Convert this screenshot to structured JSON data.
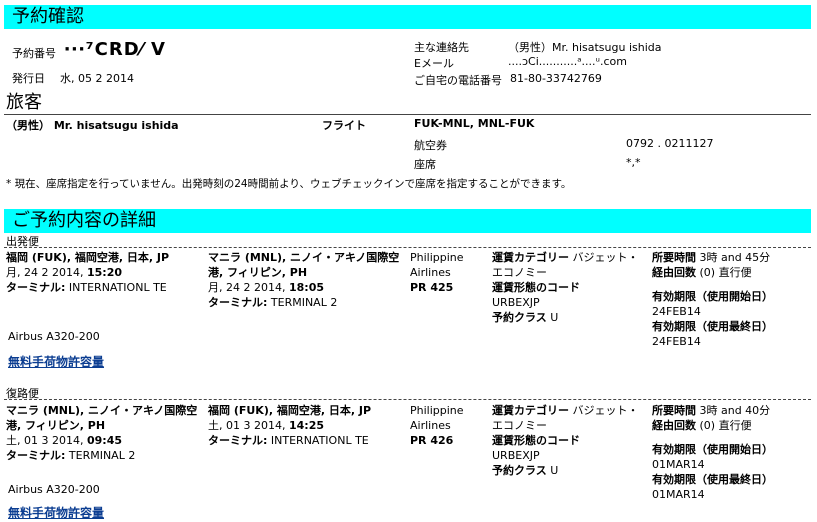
{
  "confirmation": {
    "title": "予約確認",
    "booking_no_label": "予約番号",
    "booking_no_value": "‧‧‧⁷CRD⁄ V",
    "issue_date_label": "発行日",
    "issue_date_value": "水, 05 2 2014",
    "contact_label": "主な連絡先",
    "contact_value": "（男性）Mr. hisatsugu ishida",
    "email_label": "Eメール",
    "email_value": "....ᴐCi...........ᵃ....ᵘ.com",
    "phone_label": "ご自宅の電話番号",
    "phone_value": "81-80-33742769"
  },
  "passenger": {
    "heading": "旅客",
    "name": "（男性） Mr. hisatsugu ishida",
    "flight_label": "フライト",
    "flight_value": "FUK-MNL, MNL-FUK",
    "ticket_label": "航空券",
    "ticket_value": "0792 . 0211127",
    "seat_label": "座席",
    "seat_value": "*,*",
    "note": "* 現在、座席指定を行っていません。出発時刻の24時間前より、ウェブチェックインで座席を指定することができます。"
  },
  "details": {
    "heading": "ご予約内容の詳細",
    "baggage_link": "無料手荷物許容量",
    "outbound": {
      "label": "出発便",
      "dep_airport": "福岡 (FUK), 福岡空港, 日本, JP",
      "dep_date": "月, 24 2 2014,",
      "dep_time": "15:20",
      "dep_terminal_label": "ターミナル:",
      "dep_terminal": "INTERNATIONL TE",
      "arr_airport": "マニラ (MNL), ニノイ・アキノ国際空港, フィリピン, PH",
      "arr_date": "月, 24 2 2014,",
      "arr_time": "18:05",
      "arr_terminal_label": "ターミナル:",
      "arr_terminal": "TERMINAL 2",
      "airline": "Philippine Airlines",
      "flight_no": "PR 425",
      "fare_cat_label": "運賃カテゴリー",
      "fare_cat_value": "バジェット・エコノミー",
      "fare_code_label": "運賃形態のコード",
      "fare_code_value": "URBEXJP",
      "class_label": "予約クラス",
      "class_value": "U",
      "duration_label": "所要時間",
      "duration_value": "3時 and 45分",
      "stops_label": "経由回数",
      "stops_value": "(0) 直行便",
      "valid_from_label": "有効期限（使用開始日）",
      "valid_from_value": "24FEB14",
      "valid_to_label": "有効期限（使用最終日）",
      "valid_to_value": "24FEB14",
      "aircraft": "Airbus A320-200"
    },
    "return": {
      "label": "復路便",
      "dep_airport": "マニラ (MNL), ニノイ・アキノ国際空港, フィリピン, PH",
      "dep_date": "土, 01 3 2014,",
      "dep_time": "09:45",
      "dep_terminal_label": "ターミナル:",
      "dep_terminal": "TERMINAL 2",
      "arr_airport": "福岡 (FUK), 福岡空港, 日本, JP",
      "arr_date": "土, 01 3 2014,",
      "arr_time": "14:25",
      "arr_terminal_label": "ターミナル:",
      "arr_terminal": "INTERNATIONL TE",
      "airline": "Philippine Airlines",
      "flight_no": "PR 426",
      "fare_cat_label": "運賃カテゴリー",
      "fare_cat_value": "バジェット・エコノミー",
      "fare_code_label": "運賃形態のコード",
      "fare_code_value": "URBEXJP",
      "class_label": "予約クラス",
      "class_value": "U",
      "duration_label": "所要時間",
      "duration_value": "3時 and 40分",
      "stops_label": "経由回数",
      "stops_value": "(0) 直行便",
      "valid_from_label": "有効期限（使用開始日）",
      "valid_from_value": "01MAR14",
      "valid_to_label": "有効期限（使用最終日）",
      "valid_to_value": "01MAR14",
      "aircraft": "Airbus A320-200"
    }
  }
}
